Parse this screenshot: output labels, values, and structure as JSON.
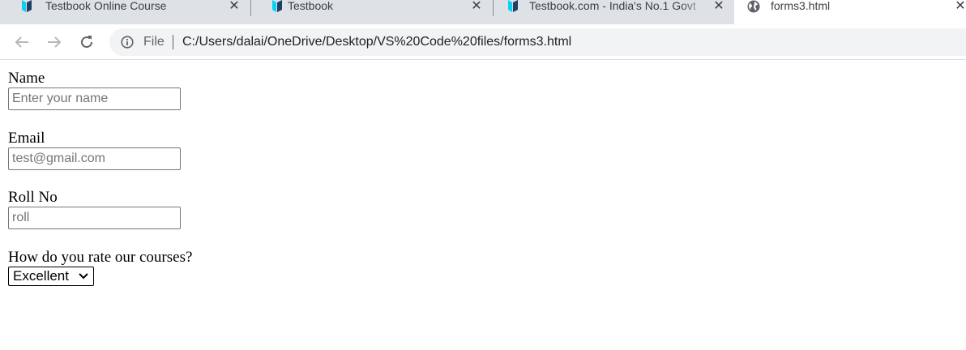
{
  "browser": {
    "tabs": [
      {
        "title": "Testbook Online Course",
        "icon": "testbook-icon"
      },
      {
        "title": "Testbook",
        "icon": "testbook-icon"
      },
      {
        "title": "Testbook.com - India's No.1 Govt",
        "icon": "testbook-icon"
      },
      {
        "title": "forms3.html",
        "icon": "globe-icon",
        "active": true
      }
    ],
    "address": {
      "scheme_label": "File",
      "url": "C:/Users/dalai/OneDrive/Desktop/VS%20Code%20files/forms3.html"
    }
  },
  "form": {
    "name_label": "Name",
    "name_placeholder": "Enter your name",
    "email_label": "Email",
    "email_placeholder": "test@gmail.com",
    "roll_label": "Roll No",
    "roll_placeholder": "roll",
    "rating_label": "How do you rate our courses?",
    "rating_selected": "Excellent"
  }
}
